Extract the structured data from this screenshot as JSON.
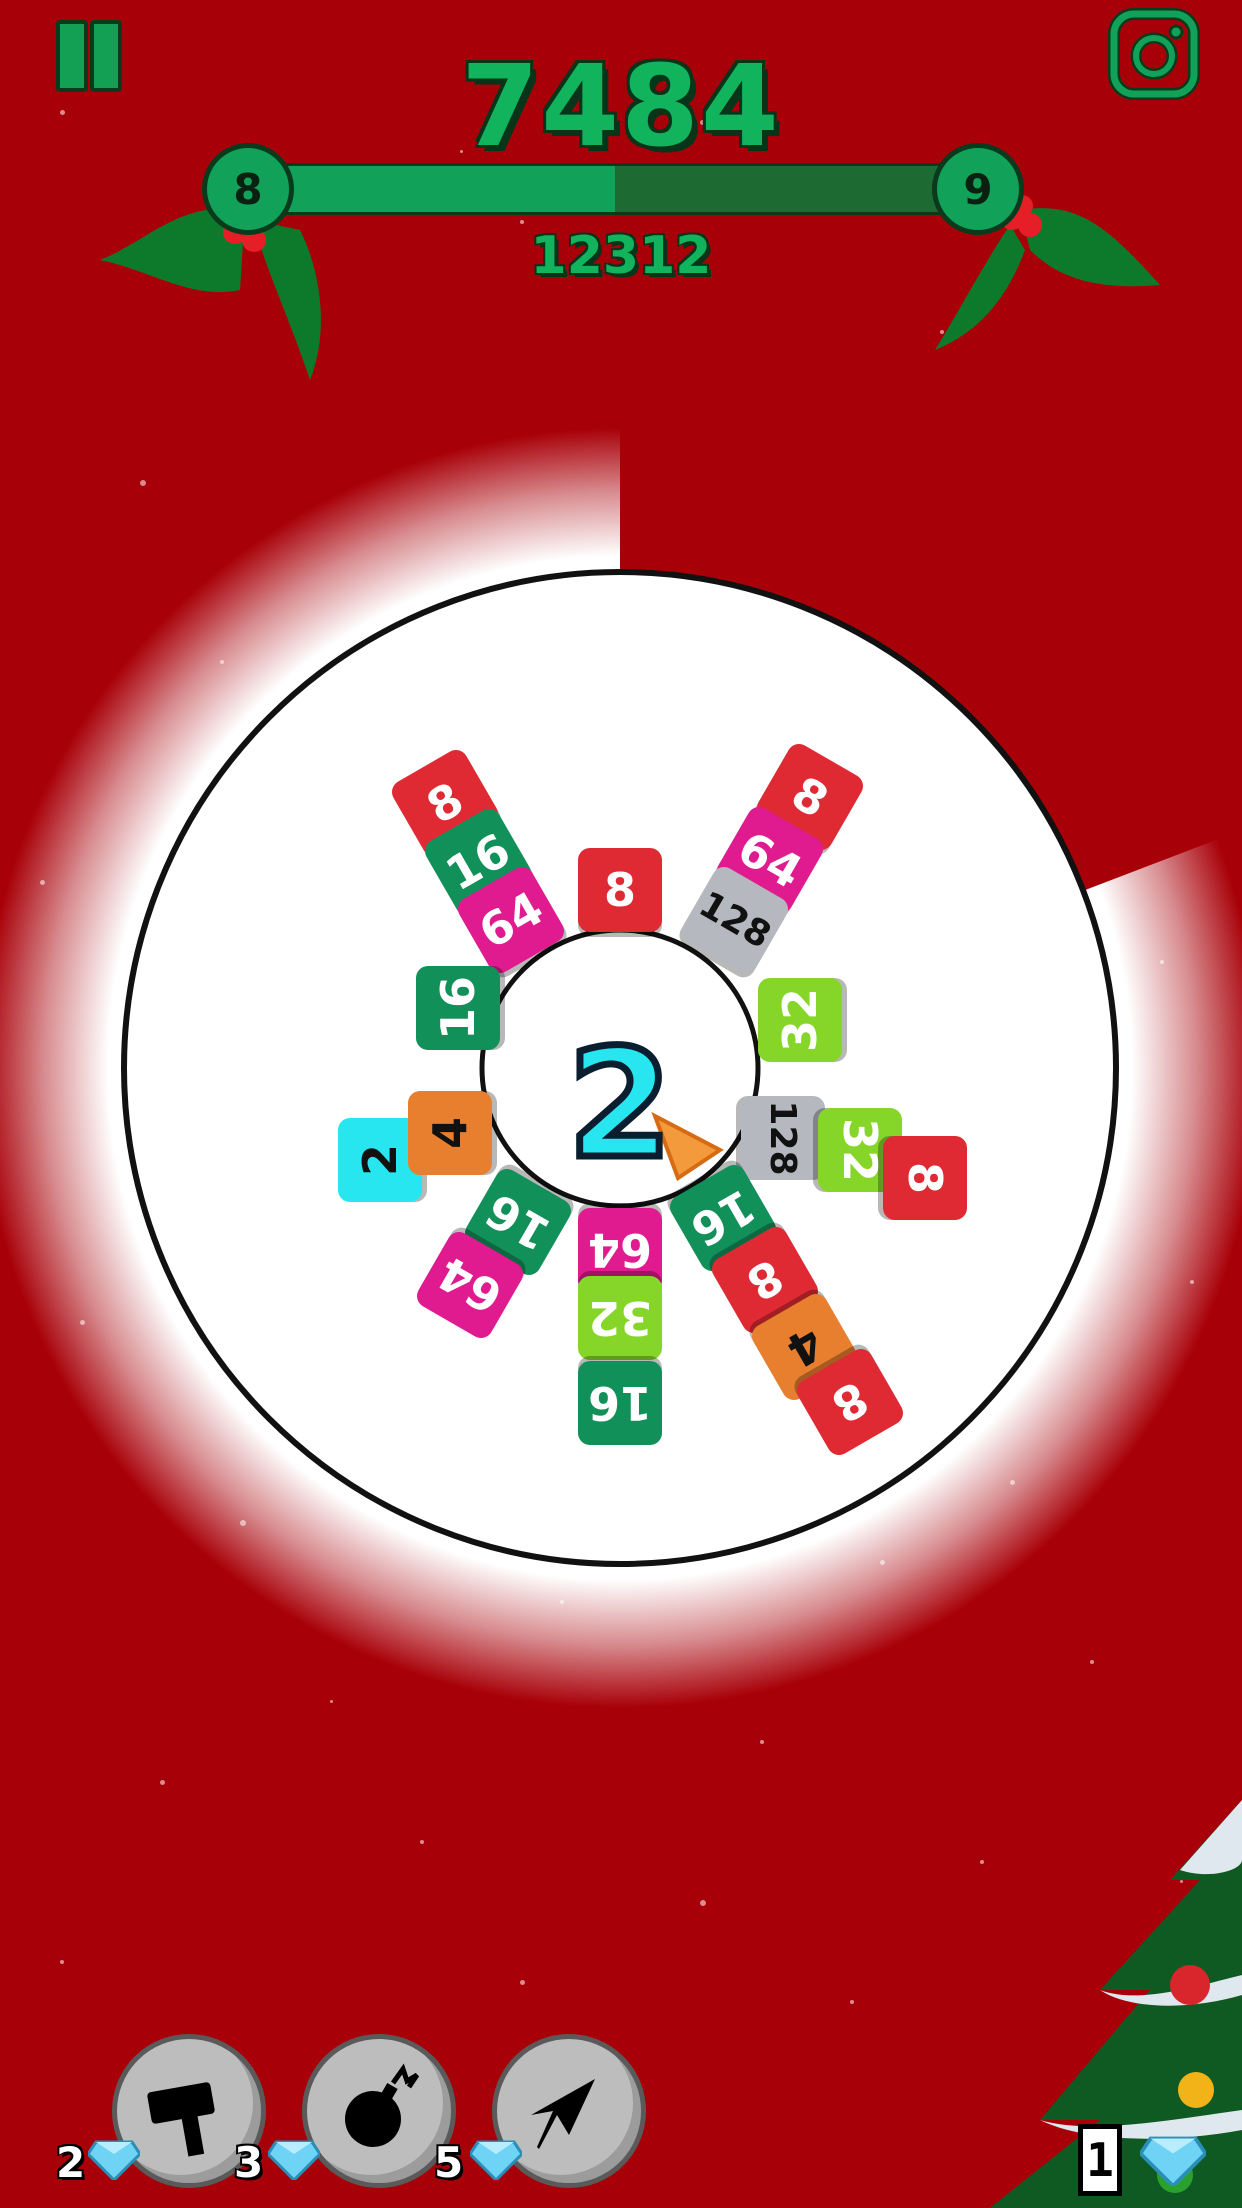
{
  "hud": {
    "score": "7484",
    "target_score": "12312",
    "current_level": "8",
    "next_level": "9",
    "level_progress": 0.5
  },
  "board": {
    "center_value": "2",
    "tiles": [
      {
        "value": "8",
        "color": "#e02a33"
      },
      {
        "value": "16",
        "color": "#12905a"
      },
      {
        "value": "64",
        "color": "#e01a8f"
      },
      {
        "value": "8",
        "color": "#e02a33"
      },
      {
        "value": "8",
        "color": "#e02a33"
      },
      {
        "value": "64",
        "color": "#e01a8f"
      },
      {
        "value": "128",
        "color": "#b5b8bf"
      },
      {
        "value": "16",
        "color": "#12905a"
      },
      {
        "value": "32",
        "color": "#86d62a"
      },
      {
        "value": "2",
        "color": "#27e6ef"
      },
      {
        "value": "4",
        "color": "#e87f2e"
      },
      {
        "value": "128",
        "color": "#b5b8bf"
      },
      {
        "value": "32",
        "color": "#86d62a"
      },
      {
        "value": "8",
        "color": "#e02a33"
      },
      {
        "value": "16",
        "color": "#12905a"
      },
      {
        "value": "64",
        "color": "#e01a8f"
      },
      {
        "value": "64",
        "color": "#e01a8f"
      },
      {
        "value": "32",
        "color": "#86d62a"
      },
      {
        "value": "16",
        "color": "#12905a"
      },
      {
        "value": "16",
        "color": "#12905a"
      },
      {
        "value": "8",
        "color": "#e02a33"
      },
      {
        "value": "4",
        "color": "#e87f2e"
      },
      {
        "value": "8",
        "color": "#e02a33"
      }
    ]
  },
  "powerups": [
    {
      "name": "hammer",
      "cost": "2",
      "icon": "hammer-icon"
    },
    {
      "name": "bomb",
      "cost": "3",
      "icon": "bomb-icon"
    },
    {
      "name": "arrow",
      "cost": "5",
      "icon": "arrow-down-icon"
    }
  ],
  "gems": {
    "count": "1"
  },
  "colors": {
    "background": "#a80008",
    "accent_green": "#11b35c",
    "center_cyan": "#27e6ef"
  }
}
